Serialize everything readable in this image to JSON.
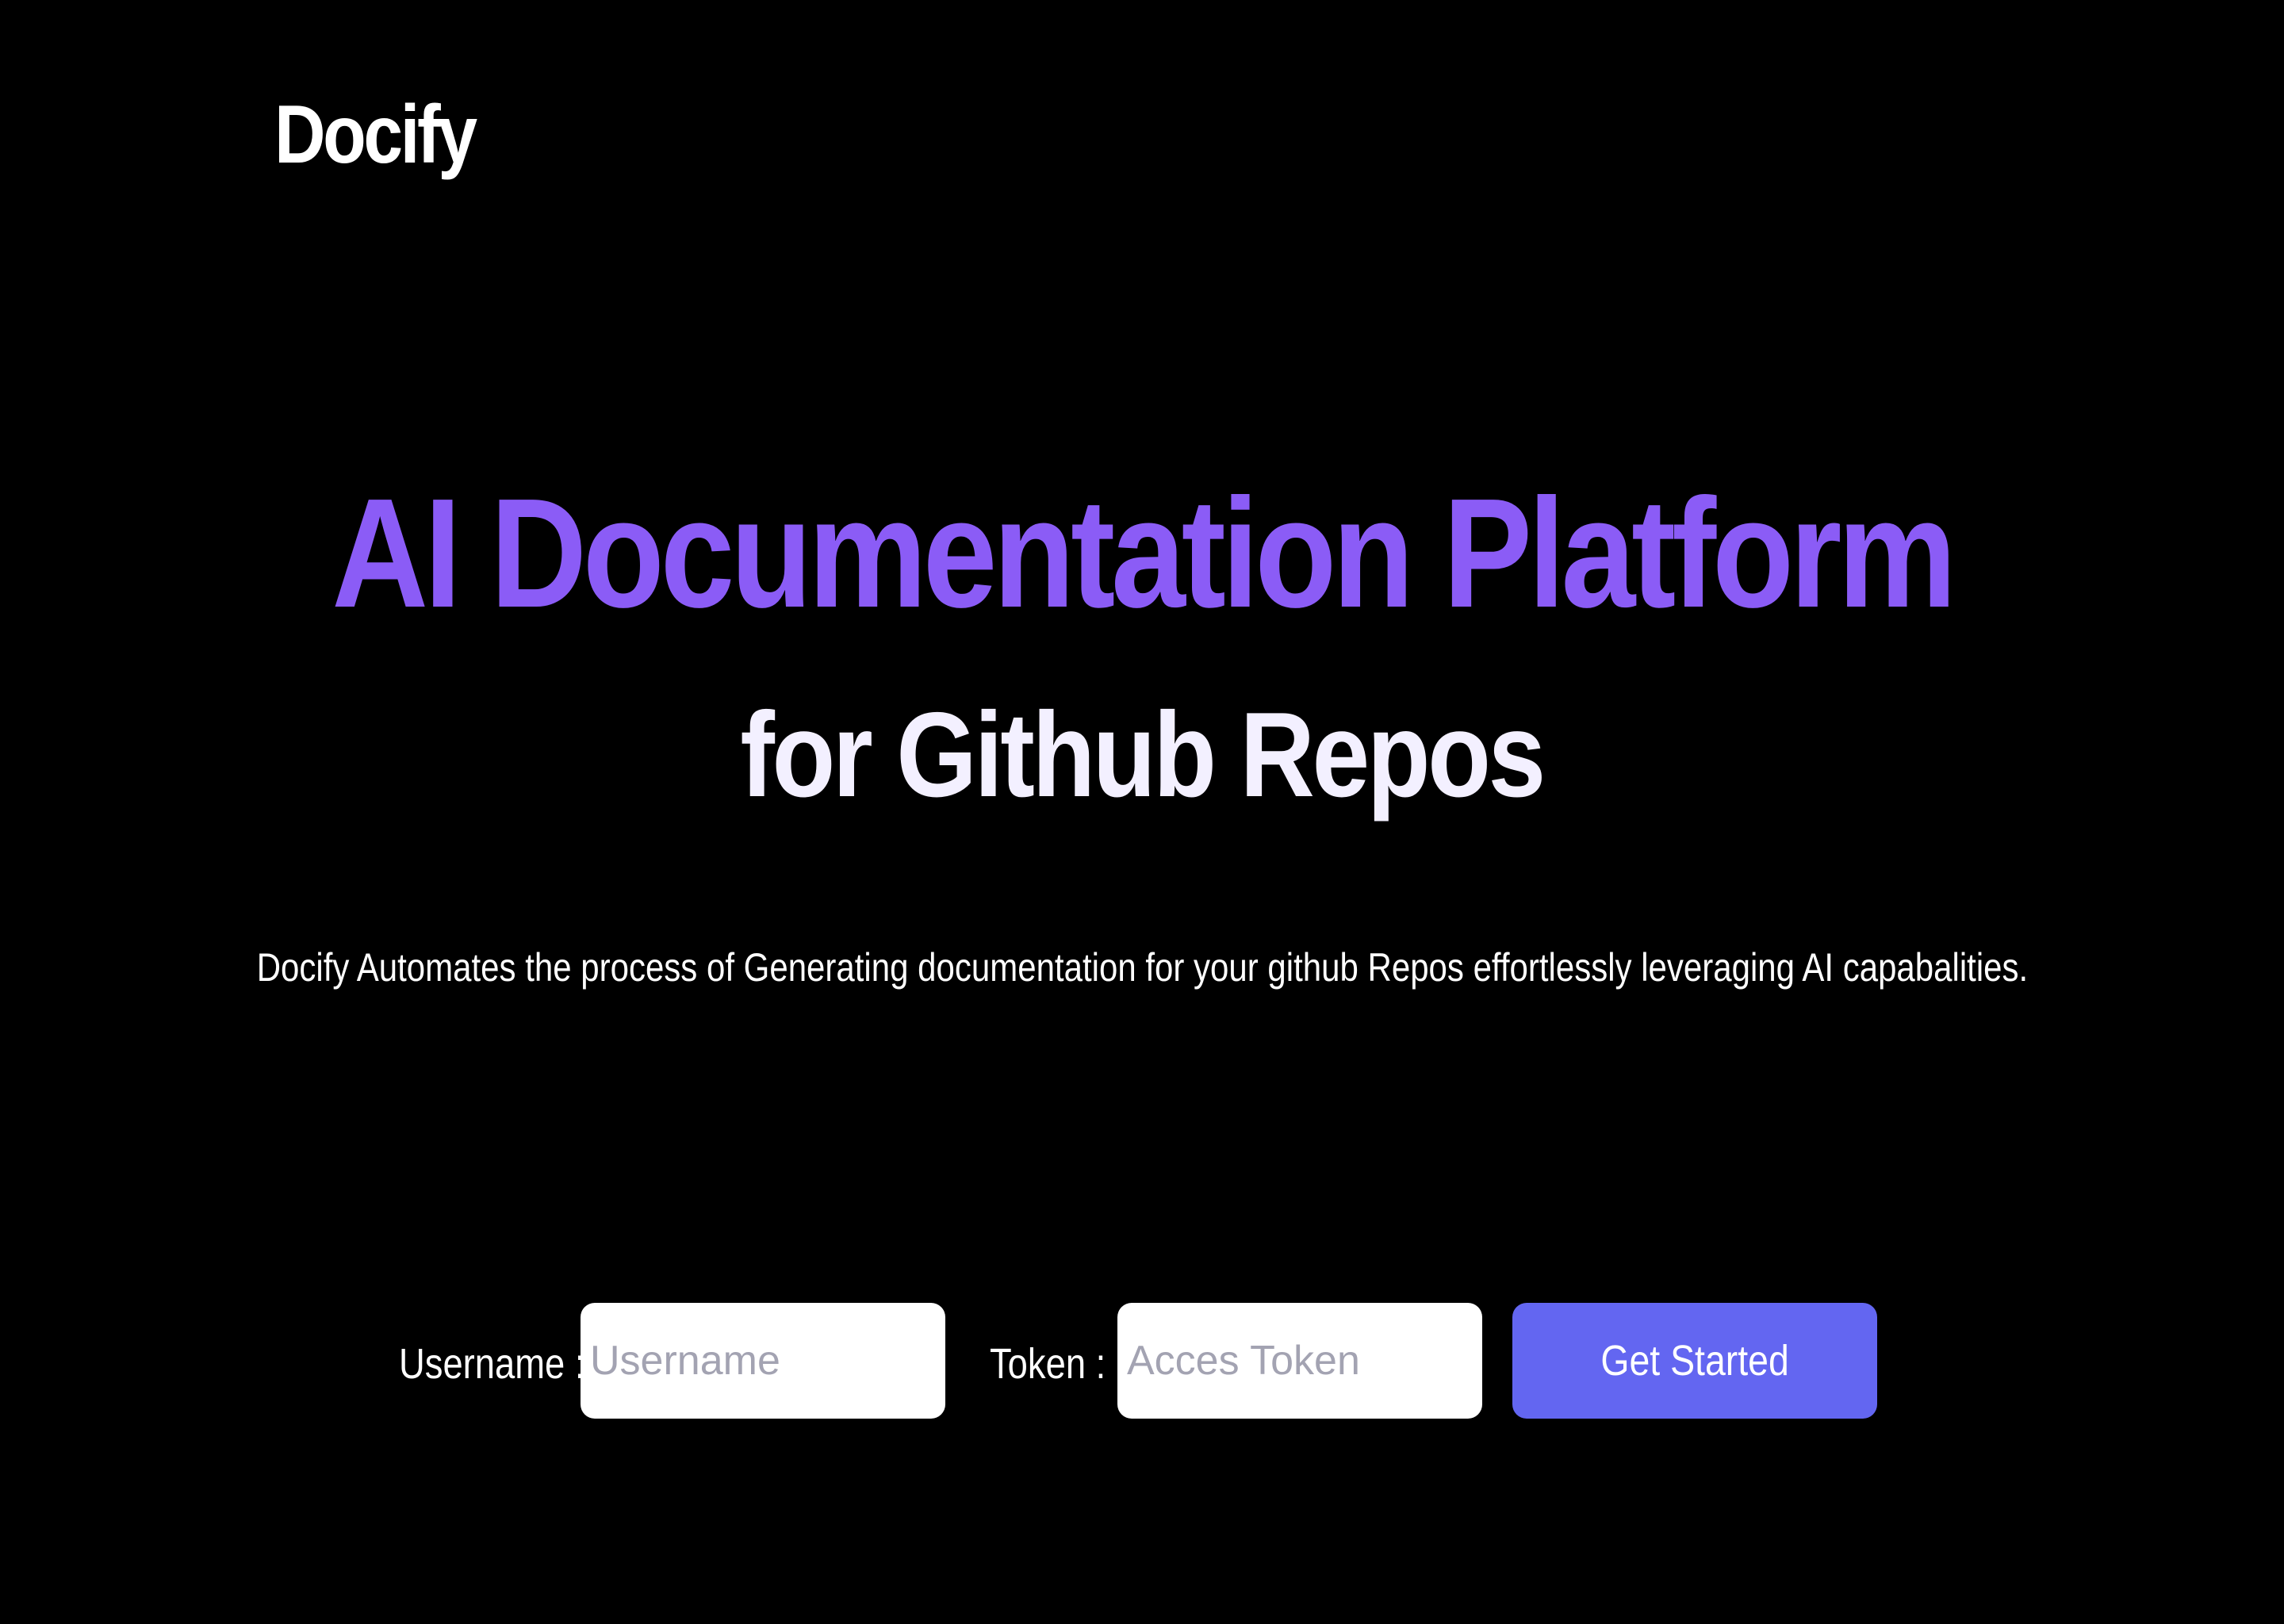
{
  "header": {
    "logo_text": "Docify"
  },
  "hero": {
    "title": "AI Documentation Platform",
    "subtitle": "for Github Repos",
    "description": "Docify Automates the process of Generating documentation for your github Repos effortlessly leveraging AI capabalities."
  },
  "form": {
    "username_label": "Username :",
    "username_placeholder": "Username",
    "username_value": "",
    "token_label": "Token :",
    "token_placeholder": "Acces Token",
    "token_value": "",
    "submit_label": "Get Started"
  },
  "colors": {
    "background": "#000000",
    "accent_purple": "#8b5cf6",
    "button": "#6366f1",
    "text": "#ffffff"
  }
}
